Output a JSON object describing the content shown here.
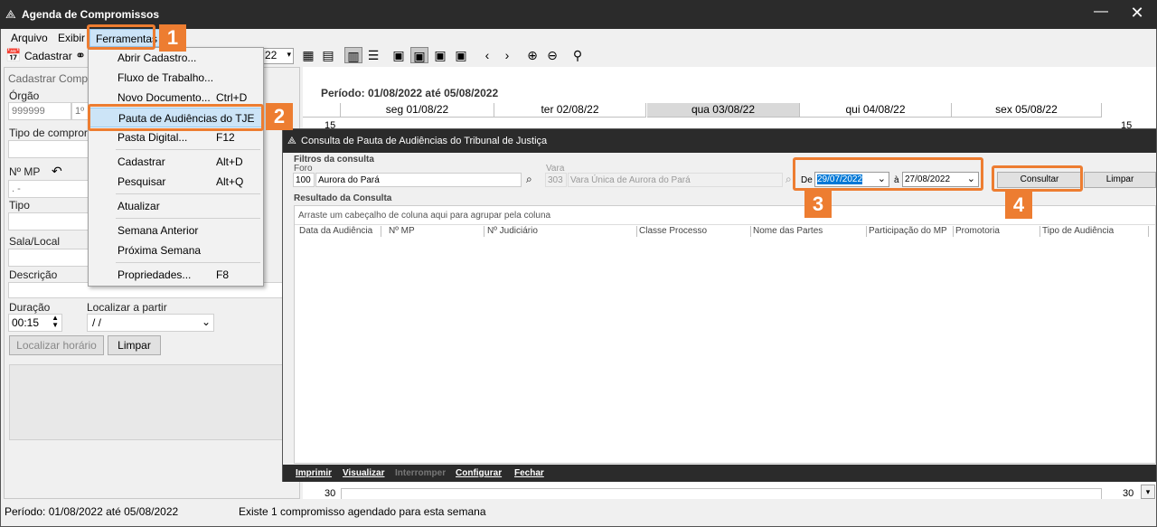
{
  "window": {
    "title": "Agenda de Compromissos"
  },
  "menubar": {
    "arquivo": "Arquivo",
    "exibir": "Exibir",
    "ferramentas": "Ferramentas"
  },
  "toolbar": {
    "cadastrar": "Cadastrar",
    "date_combo": "22"
  },
  "left_panel": {
    "header": "Cadastrar Compr",
    "orgao_label": "Órgão",
    "orgao_value": "999999",
    "orgao_code": "1º",
    "tipo_compromisso_label": "Tipo de compror",
    "n_mp_label": "Nº MP",
    "n_mp_value": "  .   -  ",
    "tipo_label": "Tipo",
    "sala_label": "Sala/Local",
    "descricao_label": "Descrição",
    "duracao_label": "Duração",
    "duracao_value": "00:15",
    "localizar_label": "Localizar a partir",
    "localizar_value": " /  /",
    "localizar_btn": "Localizar horário",
    "limpar_btn": "Limpar"
  },
  "calendar": {
    "period": "Período: 01/08/2022 até 05/08/2022",
    "days": [
      "seg 01/08/22",
      "ter 02/08/22",
      "qua 03/08/22",
      "qui 04/08/22",
      "sex 05/08/22"
    ],
    "selected_day": 2,
    "row_first": "15",
    "row_last": "30",
    "scroll_value_top": "15",
    "scroll_value_bottom": "30"
  },
  "dropdown": {
    "items": [
      {
        "label": "Abrir Cadastro...",
        "shortcut": ""
      },
      {
        "label": "Fluxo de Trabalho...",
        "shortcut": ""
      },
      {
        "label": "Novo Documento...",
        "shortcut": "Ctrl+D"
      },
      {
        "label": "Pauta de Audiências do TJE",
        "shortcut": ""
      },
      {
        "label": "Pasta Digital...",
        "shortcut": "F12"
      },
      {
        "label": "Cadastrar",
        "shortcut": "Alt+D"
      },
      {
        "label": "Pesquisar",
        "shortcut": "Alt+Q"
      },
      {
        "label": "Atualizar",
        "shortcut": ""
      },
      {
        "label": "Semana Anterior",
        "shortcut": ""
      },
      {
        "label": "Próxima Semana",
        "shortcut": ""
      },
      {
        "label": "Propriedades...",
        "shortcut": "F8"
      }
    ],
    "highlighted_index": 3
  },
  "dialog": {
    "title": "Consulta de Pauta de Audiências do Tribunal de Justiça",
    "filtros_label": "Filtros da consulta",
    "foro_label": "Foro",
    "foro_code": "100",
    "foro_name": "Aurora do Pará",
    "vara_label": "Vara",
    "vara_code": "303",
    "vara_name": "Vara Única de Aurora do Pará",
    "de_label": "De",
    "date_from": "29/07/2022",
    "a_label": "à",
    "date_to": "27/08/2022",
    "consultar_btn": "Consultar",
    "limpar_btn": "Limpar",
    "resultado_label": "Resultado da Consulta",
    "group_hint": "Arraste um cabeçalho de coluna aqui para agrupar pela coluna",
    "columns": [
      "Data da Audiência",
      "Nº MP",
      "Nº Judiciário",
      "Classe Processo",
      "Nome das Partes",
      "Participação do MP",
      "Promotoria",
      "Tipo de Audiência"
    ],
    "footer": {
      "imprimir": "Imprimir",
      "visualizar": "Visualizar",
      "interromper": "Interromper",
      "configurar": "Configurar",
      "fechar": "Fechar"
    }
  },
  "status": {
    "left": "Período: 01/08/2022 até 05/08/2022",
    "right": "Existe 1 compromisso agendado para esta semana"
  },
  "annotations": [
    "1",
    "2",
    "3",
    "4"
  ],
  "colors": {
    "highlight": "#ed7d31",
    "titlebar": "#2b2b2b",
    "menu_hover": "#cce4f7"
  }
}
